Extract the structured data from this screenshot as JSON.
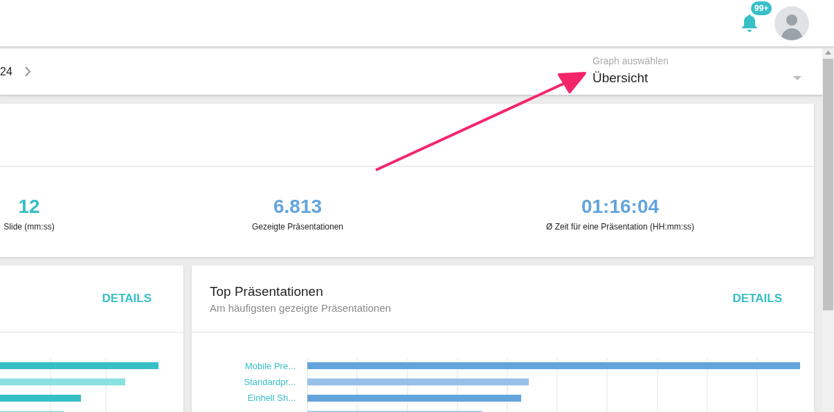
{
  "header": {
    "notification_badge": "99+"
  },
  "toolbar": {
    "date_text": "24",
    "graph_select": {
      "label": "Graph auswählen",
      "value": "Übersicht"
    }
  },
  "stats": [
    {
      "value": "12",
      "label": "Slide (mm:ss)",
      "color": "#36bfc6"
    },
    {
      "value": "6.813",
      "label": "Gezeigte Präsentationen",
      "color": "#63a4dd"
    },
    {
      "value": "01:16:04",
      "label": "Ø Zeit für eine Präsentation (HH:mm:ss)",
      "color": "#63a4dd"
    }
  ],
  "cards": [
    {
      "action": "DETAILS"
    },
    {
      "title": "Top Präsentationen",
      "subtitle": "Am häufigsten gezeigte Präsentationen",
      "action": "DETAILS",
      "bar_labels": [
        "Mobile Pre...",
        "Standardpr...",
        "Einhell Sh..."
      ]
    }
  ]
}
